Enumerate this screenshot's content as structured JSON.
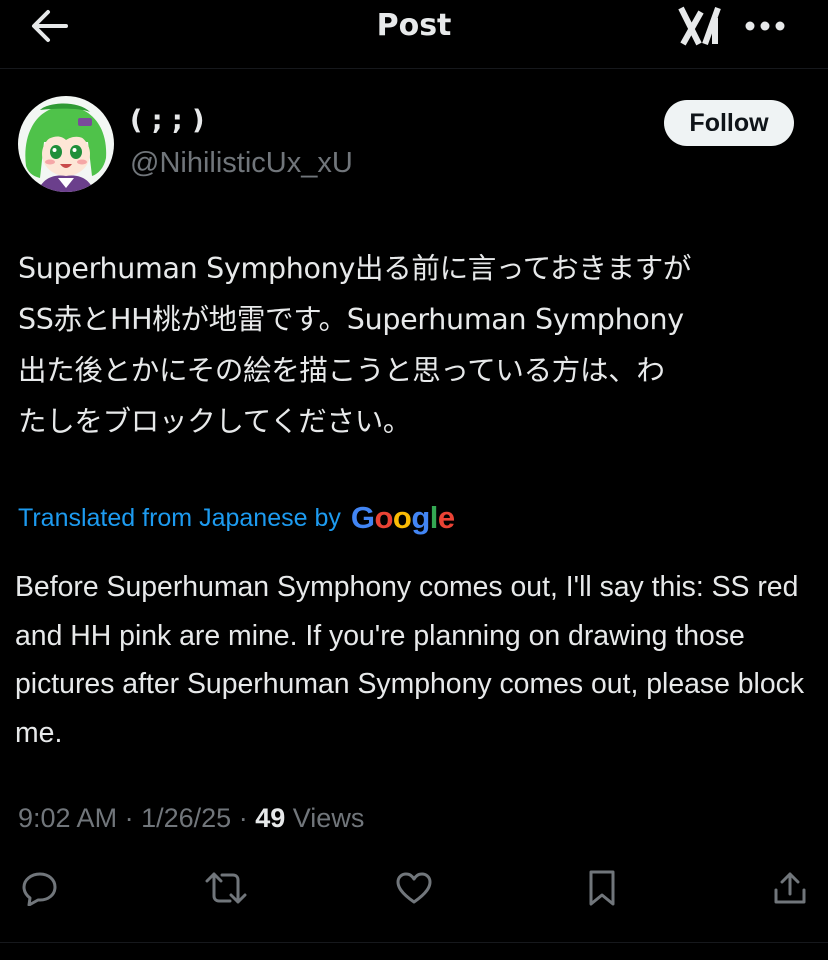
{
  "header": {
    "title": "Post",
    "back_icon": "arrow-left-icon",
    "grok_icon": "grok-icon",
    "more_icon": "more-horizontal-icon"
  },
  "author": {
    "display_name": "( ; ; )",
    "handle": "@NihilisticUx_xU",
    "follow_label": "Follow"
  },
  "post": {
    "original_text": "Superhuman Symphony出る前に言っておきますがSS赤とHH桃が地雷です。Superhuman Symphony出た後とかにその絵を描こうと思っている方は、わたしをブロックしてください。",
    "original_lines": [
      "Superhuman Symphony出る前に言っておきますが",
      "SS赤とHH桃が地雷です。Superhuman Symphony",
      "出た後とかにその絵を描こうと思っている方は、わ",
      "たしをブロックしてください。"
    ],
    "translation_label": "Translated from Japanese by",
    "translation_provider": "Google",
    "translated_text": "Before Superhuman Symphony comes out, I'll say this: SS red and HH pink are mine. If you're planning on drawing those pictures after Superhuman Symphony comes out, please block me.",
    "time": "9:02 AM",
    "date": "1/26/25",
    "separator": "·",
    "views_count": "49",
    "views_label": "Views"
  },
  "actions": {
    "reply_icon": "reply-icon",
    "repost_icon": "repost-icon",
    "like_icon": "heart-icon",
    "bookmark_icon": "bookmark-icon",
    "share_icon": "share-icon"
  },
  "colors": {
    "background": "#000000",
    "text_primary": "#e7e9ea",
    "text_secondary": "#71767b",
    "link": "#1d9bf0",
    "follow_bg": "#eff3f4",
    "google_blue": "#4285F4",
    "google_red": "#EA4335",
    "google_yellow": "#FBBC05",
    "google_green": "#34A853"
  }
}
